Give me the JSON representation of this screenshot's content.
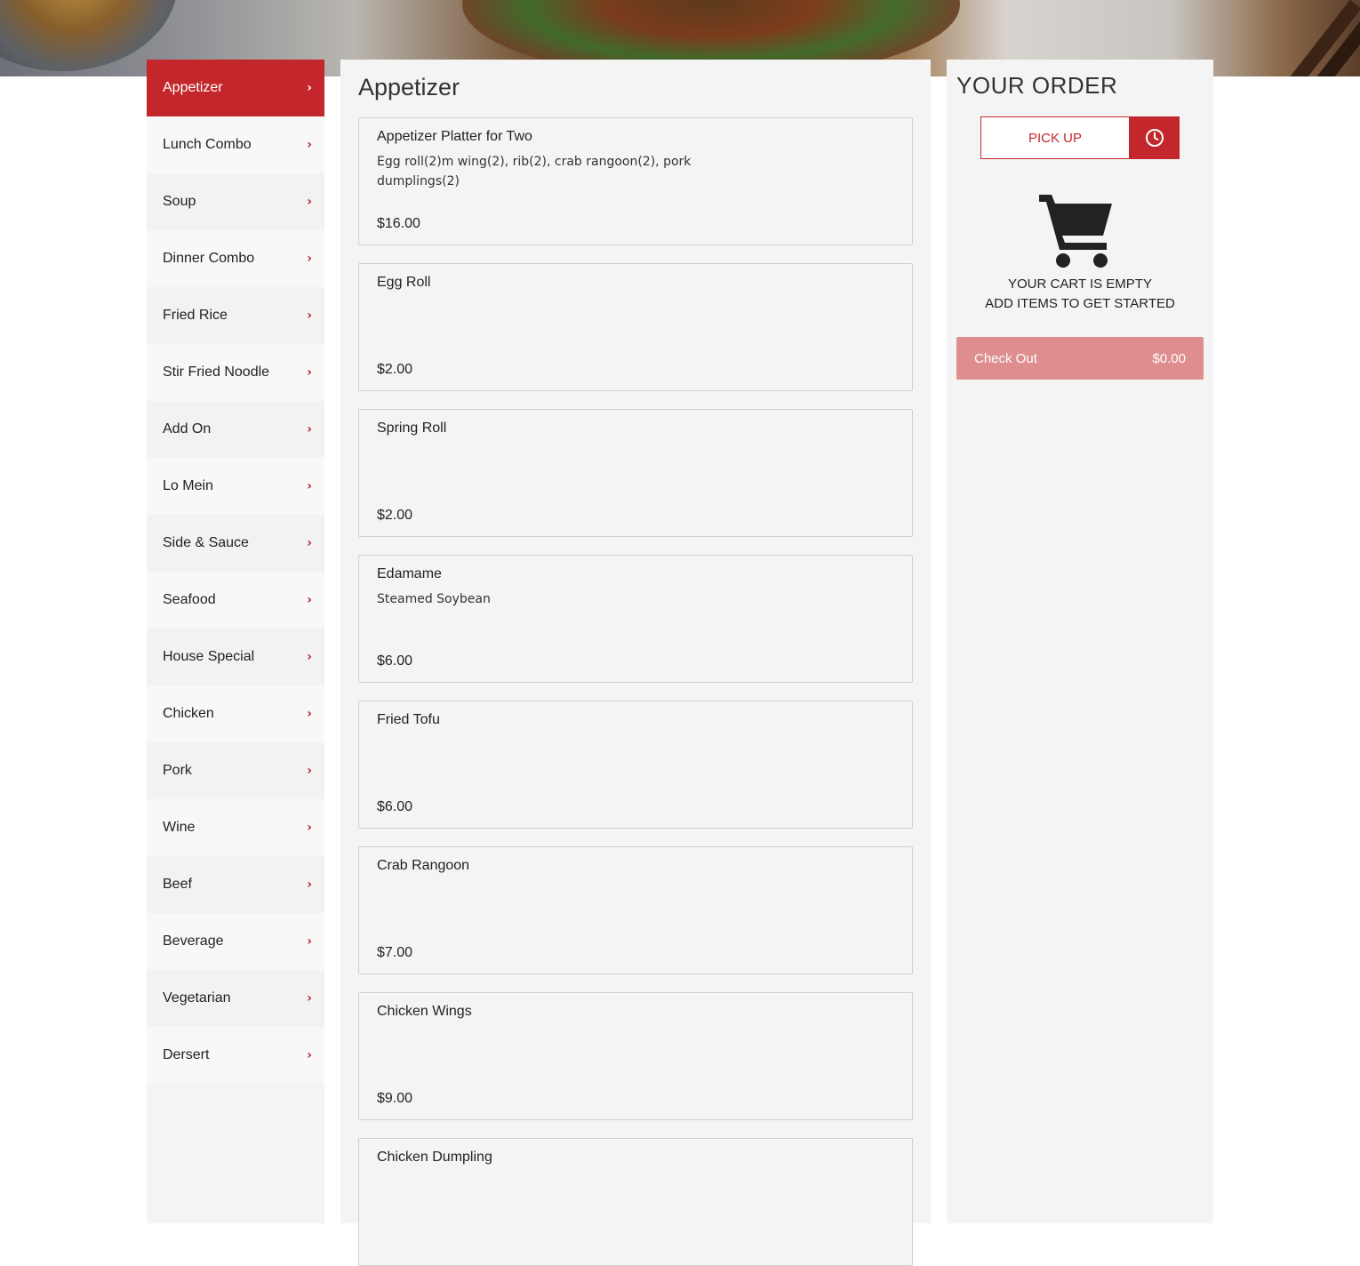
{
  "categories": [
    {
      "label": "Appetizer",
      "active": true
    },
    {
      "label": "Lunch Combo"
    },
    {
      "label": "Soup"
    },
    {
      "label": "Dinner Combo"
    },
    {
      "label": "Fried Rice"
    },
    {
      "label": "Stir Fried Noodle"
    },
    {
      "label": "Add On"
    },
    {
      "label": "Lo Mein"
    },
    {
      "label": "Side & Sauce"
    },
    {
      "label": "Seafood"
    },
    {
      "label": "House Special"
    },
    {
      "label": "Chicken"
    },
    {
      "label": "Pork"
    },
    {
      "label": "Wine"
    },
    {
      "label": "Beef"
    },
    {
      "label": "Beverage"
    },
    {
      "label": "Vegetarian"
    },
    {
      "label": "Dersert"
    }
  ],
  "menu": {
    "section_title": "Appetizer",
    "items": [
      {
        "name": "Appetizer Platter for Two",
        "description": "Egg roll(2)m wing(2), rib(2), crab rangoon(2), pork dumplings(2)",
        "price": "$16.00"
      },
      {
        "name": "Egg Roll",
        "description": "",
        "price": "$2.00"
      },
      {
        "name": "Spring Roll",
        "description": "",
        "price": "$2.00"
      },
      {
        "name": "Edamame",
        "description": "Steamed Soybean",
        "price": "$6.00"
      },
      {
        "name": "Fried Tofu",
        "description": "",
        "price": "$6.00"
      },
      {
        "name": "Crab Rangoon",
        "description": "",
        "price": "$7.00"
      },
      {
        "name": "Chicken Wings",
        "description": "",
        "price": "$9.00"
      },
      {
        "name": "Chicken Dumpling",
        "description": "",
        "price": ""
      }
    ]
  },
  "order": {
    "title": "YOUR ORDER",
    "pickup_label": "PICK UP",
    "empty_line1": "YOUR CART IS EMPTY",
    "empty_line2": "ADD ITEMS TO GET STARTED",
    "checkout_label": "Check Out",
    "checkout_total": "$0.00"
  },
  "icons": {
    "chevron": "chevron-right-icon",
    "clock": "clock-icon",
    "cart": "cart-icon"
  },
  "colors": {
    "accent": "#c3272b",
    "checkout_disabled": "#df8e8f",
    "panel_bg": "#f4f4f4"
  }
}
